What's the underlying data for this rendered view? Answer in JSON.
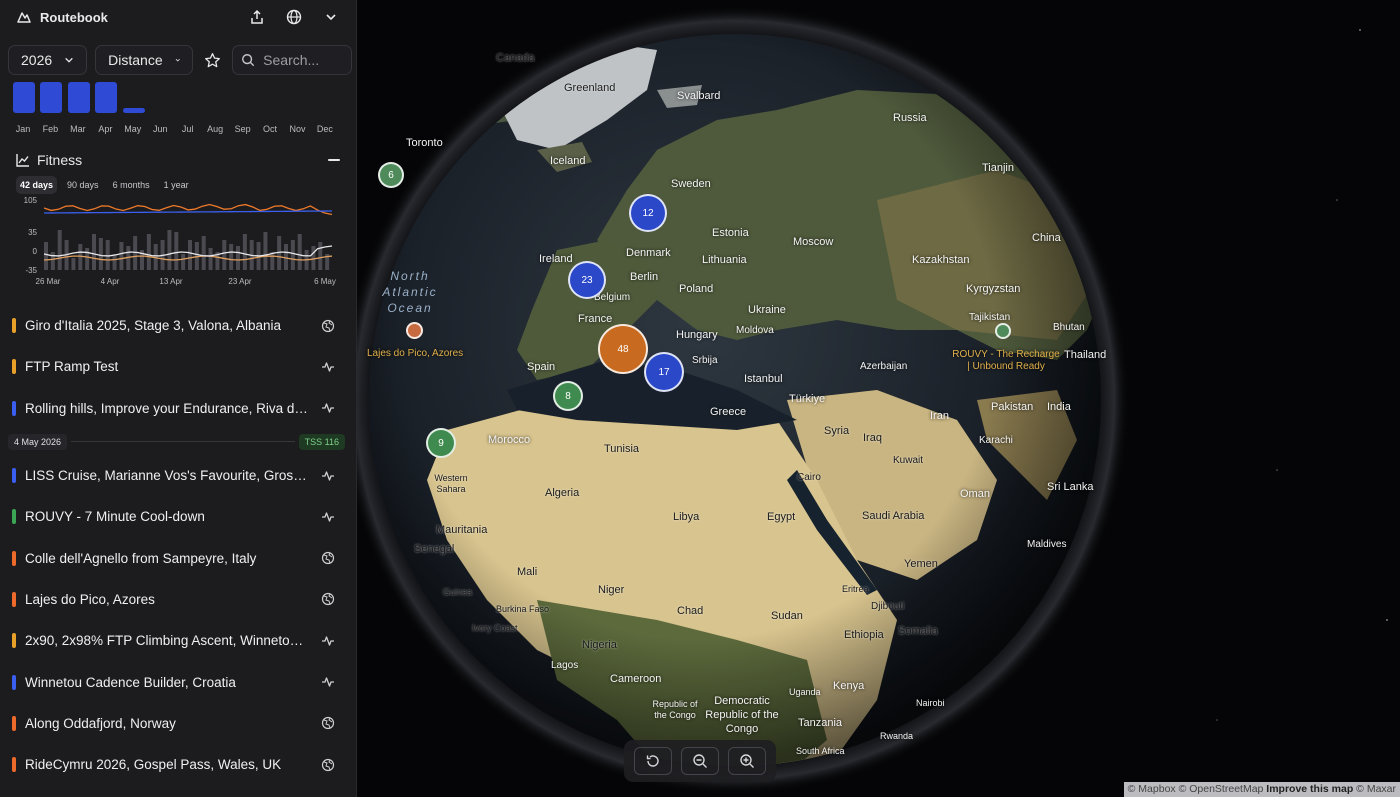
{
  "app": {
    "title": "Routebook"
  },
  "controls": {
    "year": "2026",
    "metric": "Distance",
    "search_placeholder": "Search..."
  },
  "months": [
    {
      "label": "Jan",
      "value": 1.0
    },
    {
      "label": "Feb",
      "value": 1.0
    },
    {
      "label": "Mar",
      "value": 1.0
    },
    {
      "label": "Apr",
      "value": 1.0
    },
    {
      "label": "May",
      "value": 0.15
    },
    {
      "label": "Jun",
      "value": 0
    },
    {
      "label": "Jul",
      "value": 0
    },
    {
      "label": "Aug",
      "value": 0
    },
    {
      "label": "Sep",
      "value": 0
    },
    {
      "label": "Oct",
      "value": 0
    },
    {
      "label": "Nov",
      "value": 0
    },
    {
      "label": "Dec",
      "value": 0
    }
  ],
  "fitness": {
    "title": "Fitness",
    "ranges": [
      "42 days",
      "90 days",
      "6 months",
      "1 year"
    ],
    "active_range": "42 days",
    "y_ticks": [
      "105",
      "35",
      "0",
      "-35"
    ],
    "x_ticks": [
      "26 Mar",
      "4 Apr",
      "13 Apr",
      "23 Apr",
      "6 May"
    ]
  },
  "activities_top": [
    {
      "name": "Giro d'Italia 2025, Stage 3, Valona, Albania",
      "color": "#e8a029",
      "icon": "globe-icon"
    },
    {
      "name": "FTP Ramp Test",
      "color": "#e8a029",
      "icon": "activity-icon"
    },
    {
      "name": "Rolling hills, Improve your Endurance, Riva del Garda, Italy",
      "color": "#3a5ff0",
      "icon": "activity-icon"
    }
  ],
  "date_separator": {
    "date": "4 May 2026",
    "tss": "TSS 116"
  },
  "activities_bottom": [
    {
      "name": "LISS Cruise, Marianne Vos's Favourite, Grossglockner",
      "color": "#3a5ff0",
      "icon": "activity-icon"
    },
    {
      "name": "ROUVY - 7 Minute Cool-down",
      "color": "#3aa655",
      "icon": "activity-icon"
    },
    {
      "name": "Colle dell'Agnello from Sampeyre, Italy",
      "color": "#ee6a2a",
      "icon": "globe-icon"
    },
    {
      "name": "Lajes do Pico, Azores",
      "color": "#ee6a2a",
      "icon": "globe-icon"
    },
    {
      "name": "2x90, 2x98% FTP Climbing Ascent, Winnetou Trail",
      "color": "#e8a029",
      "icon": "activity-icon"
    },
    {
      "name": "Winnetou Cadence Builder, Croatia",
      "color": "#3a5ff0",
      "icon": "activity-icon"
    },
    {
      "name": "Along Oddafjord, Norway",
      "color": "#ee6a2a",
      "icon": "globe-icon"
    },
    {
      "name": "RideCymru 2026, Gospel Pass, Wales, UK",
      "color": "#ee6a2a",
      "icon": "globe-icon"
    }
  ],
  "map": {
    "labels": [
      "Canada",
      "Greenland",
      "Svalbard",
      "Russia",
      "Toronto",
      "Iceland",
      "Sweden",
      "Tianjin",
      "Estonia",
      "Moscow",
      "China",
      "Ireland",
      "Denmark",
      "Lithuania",
      "Kazakhstan",
      "Berlin",
      "Poland",
      "Kyrgyzstan",
      "Belgium",
      "France",
      "Ukraine",
      "Tajikistan",
      "Moldova",
      "Hungary",
      "Bhutan",
      "Srbija",
      "Thailand",
      "Spain",
      "Istanbul",
      "Azerbaijan",
      "Türkiye",
      "Greece",
      "Iran",
      "Pakistan",
      "India",
      "Morocco",
      "Tunisia",
      "Syria",
      "Iraq",
      "Karachi",
      "Western Sahara",
      "Kuwait",
      "Cairo",
      "Algeria",
      "Libya",
      "Egypt",
      "Oman",
      "Sri Lanka",
      "Mauritania",
      "Saudi Arabia",
      "Senegal",
      "Maldives",
      "Mali",
      "Yemen",
      "Niger",
      "Guinea",
      "Eritrea",
      "Burkina Faso",
      "Djibouti",
      "Chad",
      "Sudan",
      "Somalia",
      "Ivory Coast",
      "Ethiopia",
      "Nigeria",
      "Lagos",
      "Cameroon",
      "Kenya",
      "Uganda",
      "Republic of the Congo",
      "Democratic Republic of the Congo",
      "Nairobi",
      "Tanzania",
      "Rwanda",
      "South Africa"
    ],
    "ocean_label": "North Atlantic Ocean",
    "places": [
      "Lajes do Pico, Azores",
      "ROUVY - The Recharge | Unbound Ready"
    ],
    "clusters": [
      {
        "count": "6",
        "color": "#4f8a5a"
      },
      {
        "count": "12",
        "color": "#2a48c8"
      },
      {
        "count": "23",
        "color": "#2a48c8"
      },
      {
        "count": "48",
        "color": "#c86a1f"
      },
      {
        "count": "17",
        "color": "#2a48c8"
      },
      {
        "count": "8",
        "color": "#3f8a4e"
      },
      {
        "count": "9",
        "color": "#3f8a4e"
      }
    ],
    "attribution": {
      "mapbox": "© Mapbox",
      "osm": "© OpenStreetMap",
      "improve": "Improve this map",
      "maxar": "© Maxar"
    }
  }
}
